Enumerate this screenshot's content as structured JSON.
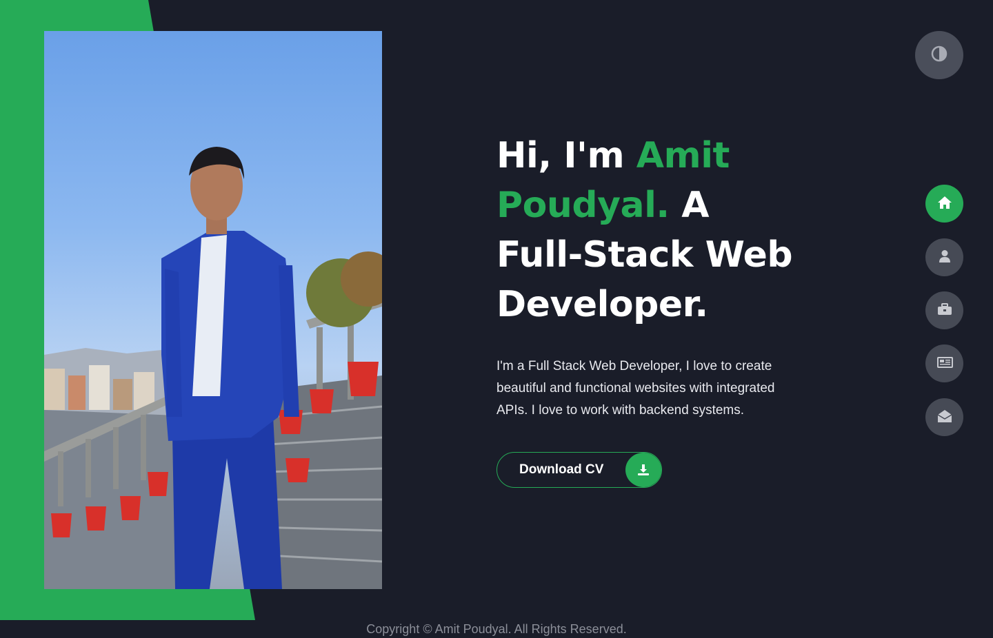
{
  "hero": {
    "greeting": "Hi, I'm ",
    "name": "Amit Poudyal.",
    "title": " A Full-Stack Web Developer.",
    "description": "I'm a Full Stack Web Developer, I love to create beautiful and functional websites with integrated APIs. I love to work with backend systems."
  },
  "cv_button": {
    "label": "Download CV",
    "icon": "download-icon"
  },
  "theme_toggle": {
    "icon": "contrast-icon"
  },
  "nav": [
    {
      "name": "home",
      "icon": "home-icon",
      "active": true
    },
    {
      "name": "about",
      "icon": "user-icon",
      "active": false
    },
    {
      "name": "portfolio",
      "icon": "briefcase-icon",
      "active": false
    },
    {
      "name": "blogs",
      "icon": "newspaper-icon",
      "active": false
    },
    {
      "name": "contact",
      "icon": "envelope-open-icon",
      "active": false
    }
  ],
  "footer": {
    "copyright": "Copyright © Amit Poudyal. All Rights Reserved."
  },
  "colors": {
    "accent": "#26ab57",
    "background": "#1a1d29",
    "nav_button": "#464a55"
  }
}
